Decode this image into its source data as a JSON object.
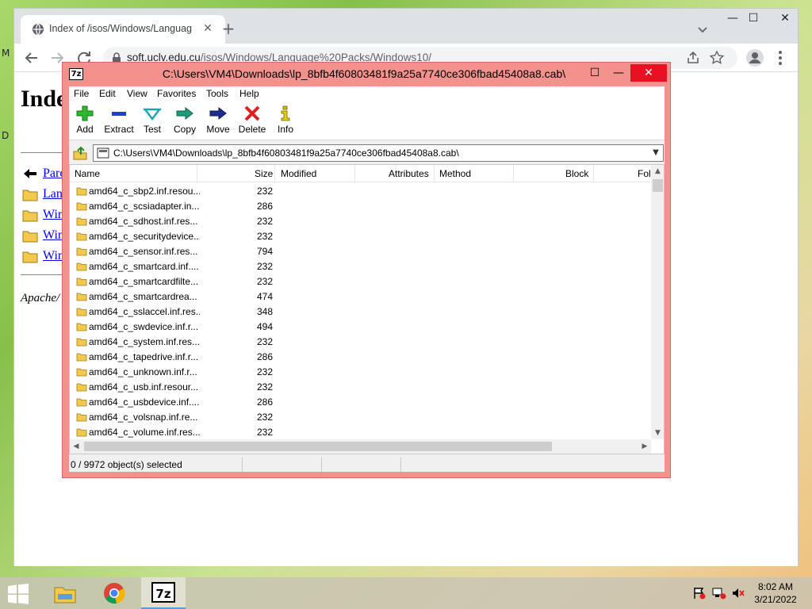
{
  "desktop": {
    "label_m": "M",
    "label_d": "D"
  },
  "chrome": {
    "tab": {
      "title": "Index of /isos/Windows/Language",
      "close": "✕"
    },
    "new_tab": "+",
    "controls": {
      "minimize": "—",
      "maximize": "☐",
      "close": "✕"
    },
    "url": {
      "host": "soft.uclv.edu.cu",
      "path": "/isos/Windows/Language%20Packs/Windows10/"
    },
    "page": {
      "heading": "Inde",
      "rows": [
        "Pare",
        "Lan",
        "Win",
        "Win",
        "Win"
      ],
      "footer": "Apache/"
    }
  },
  "zip": {
    "logo": "7z",
    "title": "C:\\Users\\VM4\\Downloads\\lp_8bfb4f60803481f9a25a7740ce306fbad45408a8.cab\\",
    "controls": {
      "minimize": "—",
      "maximize": "☐",
      "close": "✕"
    },
    "menu": [
      "File",
      "Edit",
      "View",
      "Favorites",
      "Tools",
      "Help"
    ],
    "toolbar": {
      "add": "Add",
      "extract": "Extract",
      "test": "Test",
      "copy": "Copy",
      "move": "Move",
      "delete": "Delete",
      "info": "Info"
    },
    "address": "C:\\Users\\VM4\\Downloads\\lp_8bfb4f60803481f9a25a7740ce306fbad45408a8.cab\\",
    "columns": [
      "Name",
      "Size",
      "Modified",
      "Attributes",
      "Method",
      "Block",
      "Fol"
    ],
    "rows": [
      {
        "name": "amd64_c_sbp2.inf.resou...",
        "size": "232"
      },
      {
        "name": "amd64_c_scsiadapter.in...",
        "size": "286"
      },
      {
        "name": "amd64_c_sdhost.inf.res...",
        "size": "232"
      },
      {
        "name": "amd64_c_securitydevice...",
        "size": "232"
      },
      {
        "name": "amd64_c_sensor.inf.res...",
        "size": "794"
      },
      {
        "name": "amd64_c_smartcard.inf....",
        "size": "232"
      },
      {
        "name": "amd64_c_smartcardfilte...",
        "size": "232"
      },
      {
        "name": "amd64_c_smartcardrea...",
        "size": "474"
      },
      {
        "name": "amd64_c_sslaccel.inf.res...",
        "size": "348"
      },
      {
        "name": "amd64_c_swdevice.inf.r...",
        "size": "494"
      },
      {
        "name": "amd64_c_system.inf.res...",
        "size": "232"
      },
      {
        "name": "amd64_c_tapedrive.inf.r...",
        "size": "286"
      },
      {
        "name": "amd64_c_unknown.inf.r...",
        "size": "232"
      },
      {
        "name": "amd64_c_usb.inf.resour...",
        "size": "232"
      },
      {
        "name": "amd64_c_usbdevice.inf....",
        "size": "286"
      },
      {
        "name": "amd64_c_volsnap.inf.re...",
        "size": "232"
      },
      {
        "name": "amd64_c_volume.inf.res...",
        "size": "232"
      }
    ],
    "status": "0 / 9972 object(s) selected"
  },
  "taskbar": {
    "zip_label": "7z",
    "clock": {
      "time": "8:02 AM",
      "date": "3/21/2022"
    }
  },
  "colors": {
    "zip_frame": "#f3928c",
    "close_red": "#e81123",
    "link_blue": "#0000ee",
    "folder_yellow": "#f2c94c"
  }
}
